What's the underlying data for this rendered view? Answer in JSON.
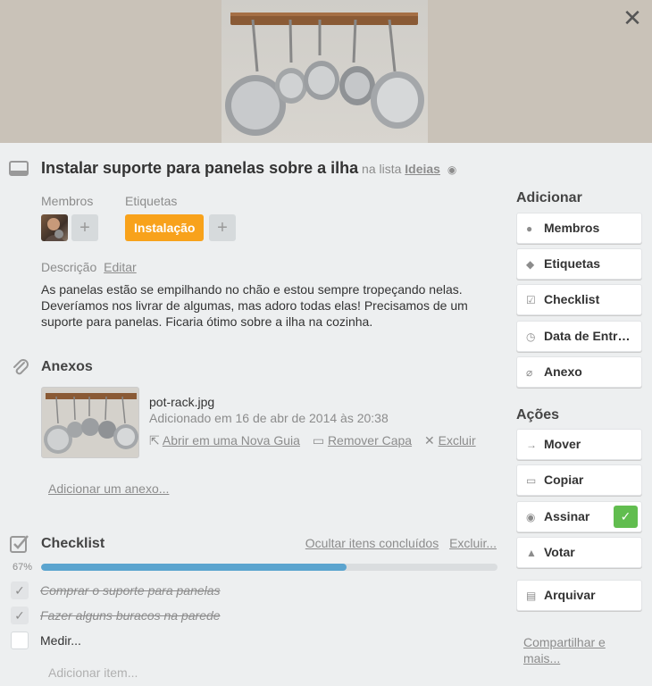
{
  "header": {
    "title": "Instalar suporte para panelas sobre a ilha",
    "in_list_prefix": "na lista",
    "list_name": "Ideias",
    "close_glyph": "✕"
  },
  "members": {
    "heading": "Membros",
    "add": "+"
  },
  "labels": {
    "heading": "Etiquetas",
    "items": [
      "Instalação"
    ],
    "add": "+",
    "color": "#f8a21b"
  },
  "description": {
    "heading": "Descrição",
    "edit": "Editar",
    "text": "As panelas estão se empilhando no chão e estou sempre tropeçando nelas. Deveríamos nos livrar de algumas, mas adoro todas elas! Precisamos de um suporte para panelas. Ficaria ótimo sobre a ilha na cozinha."
  },
  "attachments": {
    "heading": "Anexos",
    "file_name": "pot-rack.jpg",
    "added": "Adicionado em 16 de abr de 2014 às 20:38",
    "open_new_tab": "Abrir em uma Nova Guia",
    "remove_cover": "Remover Capa",
    "delete": "Excluir",
    "add": "Adicionar um anexo..."
  },
  "checklist": {
    "heading": "Checklist",
    "hide_done": "Ocultar itens concluídos",
    "delete": "Excluir...",
    "percent_label": "67%",
    "progress": 0.67,
    "items": [
      {
        "text": "Comprar o suporte para panelas",
        "done": true
      },
      {
        "text": "Fazer alguns buracos na parede",
        "done": true
      },
      {
        "text": "Medir...",
        "done": false
      }
    ],
    "add_item": "Adicionar item..."
  },
  "sidebar": {
    "add_heading": "Adicionar",
    "add_buttons": [
      "Membros",
      "Etiquetas",
      "Checklist",
      "Data de Entr…",
      "Anexo"
    ],
    "actions_heading": "Ações",
    "action_buttons": [
      "Mover",
      "Copiar",
      "Assinar",
      "Votar",
      "Arquivar"
    ],
    "share": "Compartilhar e mais..."
  },
  "colors": {
    "accent_green": "#61bd4f",
    "progress_blue": "#5ba4cf",
    "label_orange": "#f8a21b"
  }
}
